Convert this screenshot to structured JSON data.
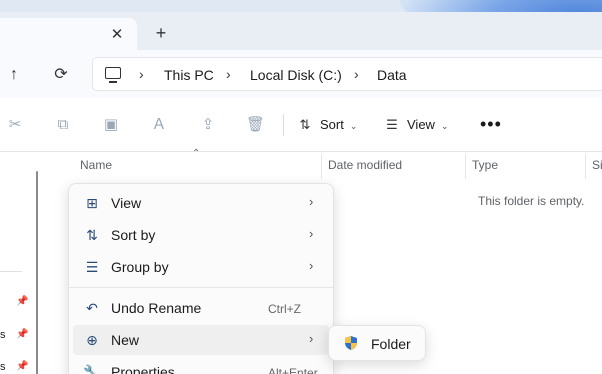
{
  "tabs": {
    "close_glyph": "✕",
    "new_glyph": "+"
  },
  "nav": {
    "up_glyph": "↑",
    "refresh_glyph": "⟳"
  },
  "address": {
    "crumbs": [
      "This PC",
      "Local Disk (C:)",
      "Data"
    ],
    "separator": "›"
  },
  "toolbar": {
    "cut_icon": "✂",
    "copy_icon": "⧉",
    "paste_icon": "▣",
    "rename_icon": "Ａ",
    "share_icon": "⇪",
    "delete_icon": "🗑",
    "sort_label": "Sort",
    "view_label": "View",
    "more_label": "•••",
    "chevron": "⌄"
  },
  "columns": {
    "name": "Name",
    "date_modified": "Date modified",
    "type": "Type",
    "size": "Si",
    "sort_caret": "⌃"
  },
  "empty_message": "This folder is empty.",
  "left_pane": {
    "items": [
      "s",
      "s"
    ],
    "pin_glyph": "📌"
  },
  "context_menu": {
    "items": [
      {
        "label": "View",
        "icon": "grid-icon",
        "glyph": "⊞",
        "has_submenu": true
      },
      {
        "label": "Sort by",
        "icon": "sort-icon",
        "glyph": "⇅",
        "has_submenu": true
      },
      {
        "label": "Group by",
        "icon": "group-icon",
        "glyph": "☰",
        "has_submenu": true
      },
      {
        "label": "Undo Rename",
        "icon": "undo-icon",
        "glyph": "↶",
        "shortcut": "Ctrl+Z"
      },
      {
        "label": "New",
        "icon": "new-icon",
        "glyph": "⊕",
        "has_submenu": true,
        "highlighted": true
      },
      {
        "label": "Properties",
        "icon": "wrench-icon",
        "glyph": "🔧",
        "shortcut": "Alt+Enter"
      }
    ],
    "arrow_glyph": "›"
  },
  "submenu": {
    "label": "Folder",
    "icon": "shield-folder-icon"
  },
  "colors": {
    "accent": "#1a5fb4",
    "menu_bg": "#fbfbfb",
    "highlight": "#efefef"
  }
}
